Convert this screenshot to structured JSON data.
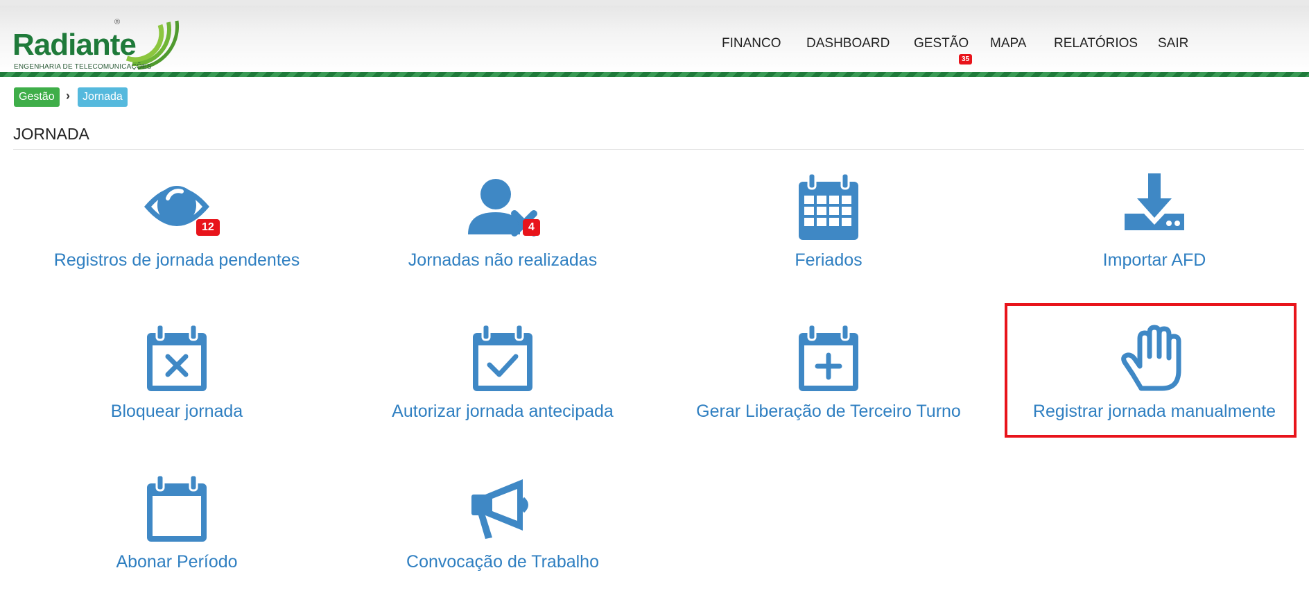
{
  "logo": {
    "name": "Radiante",
    "subtitle": "ENGENHARIA DE TELECOMUNICAÇÕES",
    "reg": "®"
  },
  "nav": {
    "items": [
      {
        "label": "FINANCO"
      },
      {
        "label": "DASHBOARD"
      },
      {
        "label": "GESTÃO",
        "badge": "35"
      },
      {
        "label": "MAPA"
      },
      {
        "label": "RELATÓRIOS"
      },
      {
        "label": "SAIR"
      }
    ]
  },
  "breadcrumb": [
    {
      "label": "Gestão",
      "color": "#3fae49"
    },
    {
      "label": "Jornada",
      "color": "#55b9dd"
    }
  ],
  "page": {
    "title": "JORNADA"
  },
  "tiles": [
    {
      "label": "Registros de jornada pendentes",
      "icon": "eye-icon",
      "badge": "12"
    },
    {
      "label": "Jornadas não realizadas",
      "icon": "user-x-icon",
      "badge": "4"
    },
    {
      "label": "Feriados",
      "icon": "calendar-grid-icon"
    },
    {
      "label": "Importar AFD",
      "icon": "download-icon"
    },
    {
      "label": "Bloquear jornada",
      "icon": "calendar-x-icon"
    },
    {
      "label": "Autorizar jornada antecipada",
      "icon": "calendar-check-icon"
    },
    {
      "label": "Gerar Liberação de Terceiro Turno",
      "icon": "calendar-plus-icon"
    },
    {
      "label": "Registrar jornada manualmente",
      "icon": "hand-icon",
      "highlighted": true
    },
    {
      "label": "Abonar Período",
      "icon": "calendar-empty-icon"
    },
    {
      "label": "Convocação de Trabalho",
      "icon": "megaphone-icon"
    }
  ],
  "colors": {
    "accent": "#2f7fc1",
    "icon": "#3f88c5",
    "brand": "#1f7a3a",
    "badge": "#e8141b"
  }
}
